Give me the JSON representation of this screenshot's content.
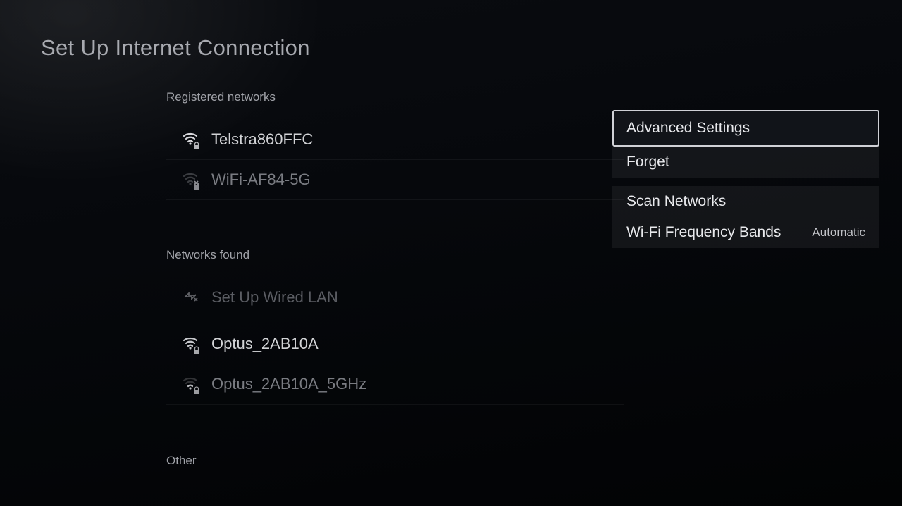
{
  "title": "Set Up Internet Connection",
  "sections": {
    "registered": {
      "label": "Registered networks",
      "items": [
        {
          "name": "Telstra860FFC",
          "signal": "strong",
          "locked": true,
          "connected": true
        },
        {
          "name": "WiFi-AF84-5G",
          "signal": "none",
          "locked": true,
          "connected": false
        }
      ]
    },
    "found": {
      "label": "Networks found",
      "wired": {
        "name": "Set Up Wired LAN",
        "connected": false
      },
      "items": [
        {
          "name": "Optus_2AB10A",
          "signal": "strong",
          "locked": true
        },
        {
          "name": "Optus_2AB10A_5GHz",
          "signal": "weak",
          "locked": true
        }
      ]
    },
    "other": {
      "label": "Other"
    }
  },
  "context_menu": {
    "group1": [
      {
        "label": "Advanced Settings",
        "selected": true
      },
      {
        "label": "Forget",
        "selected": false
      }
    ],
    "group2": [
      {
        "label": "Scan Networks",
        "value": ""
      },
      {
        "label": "Wi-Fi Frequency Bands",
        "value": "Automatic"
      }
    ]
  }
}
